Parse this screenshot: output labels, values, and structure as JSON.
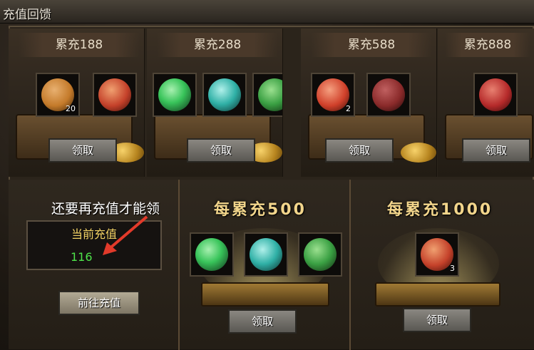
{
  "window": {
    "title": "充值回馈"
  },
  "tiers": [
    {
      "label": "累充188",
      "claim": "领取",
      "items": [
        {
          "icon": "scroll-icon",
          "count": "20",
          "color": "#c47a2a"
        },
        {
          "icon": "red-gem-icon",
          "count": "",
          "color": "#c4412a"
        }
      ]
    },
    {
      "label": "累充288",
      "claim": "领取",
      "items": [
        {
          "icon": "green-orb-icon",
          "count": "",
          "color": "#38c45a"
        },
        {
          "icon": "teal-jade-icon",
          "count": "",
          "color": "#2fb0a6"
        }
      ]
    },
    {
      "label": "累充588",
      "claim": "领取",
      "items": [
        {
          "icon": "red-potion-icon",
          "count": "2",
          "color": "#d0402a"
        },
        {
          "icon": "armor-icon",
          "count": "",
          "color": "#8a2a2a"
        }
      ]
    },
    {
      "label": "累充888",
      "claim": "领取",
      "items": [
        {
          "icon": "red-book-icon",
          "count": "",
          "color": "#b52a2a"
        }
      ]
    }
  ],
  "recharge": {
    "hint": "还要再充值才能领",
    "current_label": "当前充值",
    "current_value": "116",
    "goto_button": "前往充值"
  },
  "every500": {
    "title": "每累充500",
    "claim": "领取",
    "items": [
      {
        "icon": "green-orb-icon",
        "color": "#38c45a"
      },
      {
        "icon": "teal-jade-icon",
        "color": "#2fb0a6"
      },
      {
        "icon": "green-pendant-icon",
        "color": "#3aa043"
      }
    ]
  },
  "every1000": {
    "title": "每累充1000",
    "claim": "领取",
    "items": [
      {
        "icon": "red-gem-icon",
        "count": "3",
        "color": "#c4412a"
      }
    ]
  },
  "colors": {
    "gold": "#f2d58b",
    "green_value": "#4ee34a",
    "yellow_label": "#f2d264"
  }
}
